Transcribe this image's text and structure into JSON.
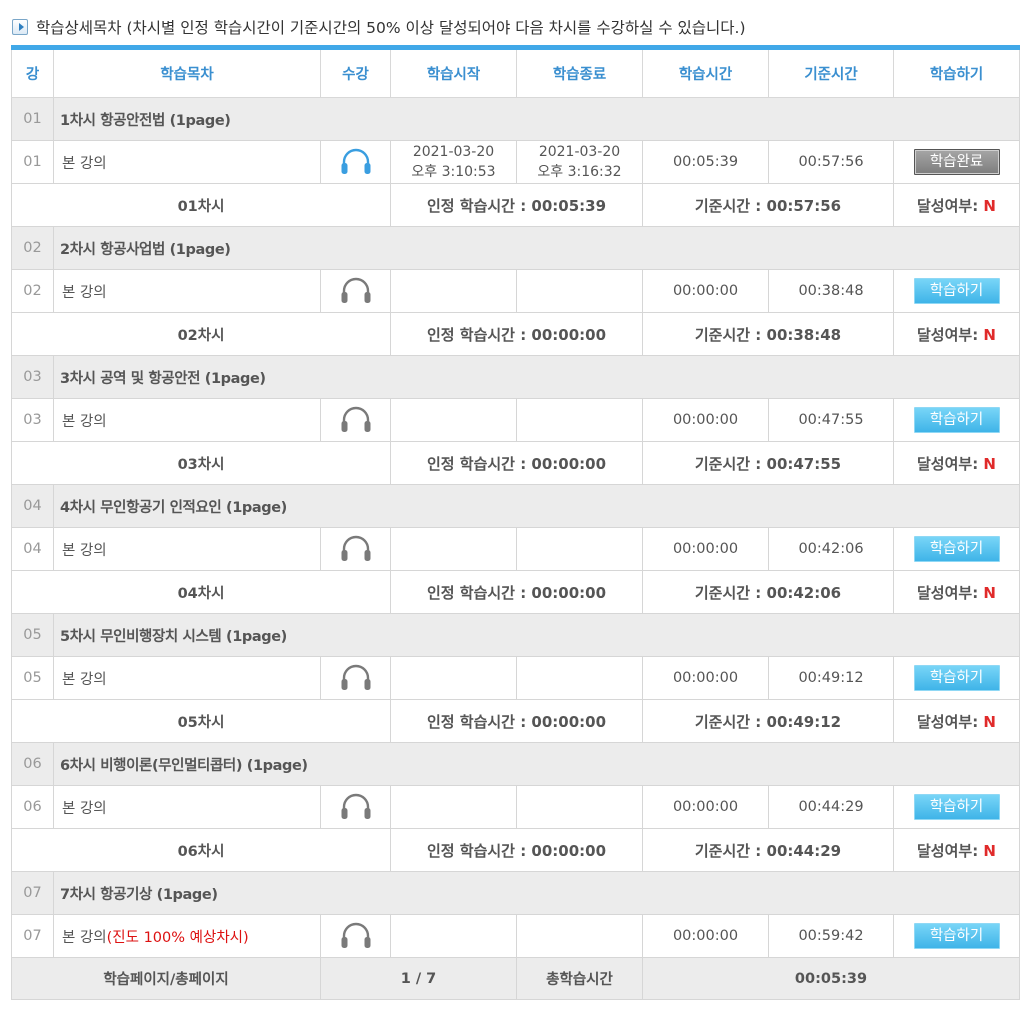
{
  "header": {
    "title": "학습상세목차 (차시별 인정 학습시간이 기준시간의 50% 이상 달성되어야 다음 차시를 수강하실 수 있습니다.)"
  },
  "columns": [
    "강",
    "학습목차",
    "수강",
    "학습시작",
    "학습종료",
    "학습시간",
    "기준시간",
    "학습하기"
  ],
  "sections": [
    {
      "num": "01",
      "title": "1차시 항공안전법 (1page)",
      "lecture": "본 강의",
      "progress_note": "",
      "start": [
        "2021-03-20",
        "오후 3:10:53"
      ],
      "end": [
        "2021-03-20",
        "오후 3:16:32"
      ],
      "study_time": "00:05:39",
      "base_time": "00:57:56",
      "button": "학습완료",
      "button_state": "done",
      "icon_active": true,
      "summary": {
        "label": "01차시",
        "recognized": "인정 학습시간 : 00:05:39",
        "base": "기준시간 : 00:57:56",
        "achieved_label": "달성여부: ",
        "achieved_value": "N"
      }
    },
    {
      "num": "02",
      "title": "2차시 항공사업법 (1page)",
      "lecture": "본 강의",
      "progress_note": "",
      "start": [
        "",
        ""
      ],
      "end": [
        "",
        ""
      ],
      "study_time": "00:00:00",
      "base_time": "00:38:48",
      "button": "학습하기",
      "button_state": "go",
      "icon_active": false,
      "summary": {
        "label": "02차시",
        "recognized": "인정 학습시간 : 00:00:00",
        "base": "기준시간 : 00:38:48",
        "achieved_label": "달성여부: ",
        "achieved_value": "N"
      }
    },
    {
      "num": "03",
      "title": "3차시 공역 및 항공안전 (1page)",
      "lecture": "본 강의",
      "progress_note": "",
      "start": [
        "",
        ""
      ],
      "end": [
        "",
        ""
      ],
      "study_time": "00:00:00",
      "base_time": "00:47:55",
      "button": "학습하기",
      "button_state": "go",
      "icon_active": false,
      "summary": {
        "label": "03차시",
        "recognized": "인정 학습시간 : 00:00:00",
        "base": "기준시간 : 00:47:55",
        "achieved_label": "달성여부: ",
        "achieved_value": "N"
      }
    },
    {
      "num": "04",
      "title": "4차시 무인항공기 인적요인 (1page)",
      "lecture": "본 강의",
      "progress_note": "",
      "start": [
        "",
        ""
      ],
      "end": [
        "",
        ""
      ],
      "study_time": "00:00:00",
      "base_time": "00:42:06",
      "button": "학습하기",
      "button_state": "go",
      "icon_active": false,
      "summary": {
        "label": "04차시",
        "recognized": "인정 학습시간 : 00:00:00",
        "base": "기준시간 : 00:42:06",
        "achieved_label": "달성여부: ",
        "achieved_value": "N"
      }
    },
    {
      "num": "05",
      "title": "5차시 무인비행장치 시스템 (1page)",
      "lecture": "본 강의",
      "progress_note": "",
      "start": [
        "",
        ""
      ],
      "end": [
        "",
        ""
      ],
      "study_time": "00:00:00",
      "base_time": "00:49:12",
      "button": "학습하기",
      "button_state": "go",
      "icon_active": false,
      "summary": {
        "label": "05차시",
        "recognized": "인정 학습시간 : 00:00:00",
        "base": "기준시간 : 00:49:12",
        "achieved_label": "달성여부: ",
        "achieved_value": "N"
      }
    },
    {
      "num": "06",
      "title": "6차시 비행이론(무인멀티콥터) (1page)",
      "lecture": "본 강의",
      "progress_note": "",
      "start": [
        "",
        ""
      ],
      "end": [
        "",
        ""
      ],
      "study_time": "00:00:00",
      "base_time": "00:44:29",
      "button": "학습하기",
      "button_state": "go",
      "icon_active": false,
      "summary": {
        "label": "06차시",
        "recognized": "인정 학습시간 : 00:00:00",
        "base": "기준시간 : 00:44:29",
        "achieved_label": "달성여부: ",
        "achieved_value": "N"
      }
    },
    {
      "num": "07",
      "title": "7차시 항공기상 (1page)",
      "lecture": "본 강의",
      "progress_note": "(진도 100% 예상차시)",
      "start": [
        "",
        ""
      ],
      "end": [
        "",
        ""
      ],
      "study_time": "00:00:00",
      "base_time": "00:59:42",
      "button": "학습하기",
      "button_state": "go",
      "icon_active": false,
      "summary": null
    }
  ],
  "footer": {
    "page_label": "학습페이지/총페이지",
    "page_value": "1 / 7",
    "total_label": "총학습시간",
    "total_value": "00:05:39"
  },
  "colors": {
    "accent": "#40a8e8",
    "header_text": "#3a8fd0",
    "headphone_active": "#3a9ee0",
    "headphone_inactive": "#7a7a7a",
    "no_flag": "#e02a2a",
    "progress_note": "#d11111"
  },
  "icons": {
    "header": "play-square-icon",
    "listen": "headphones-icon"
  }
}
